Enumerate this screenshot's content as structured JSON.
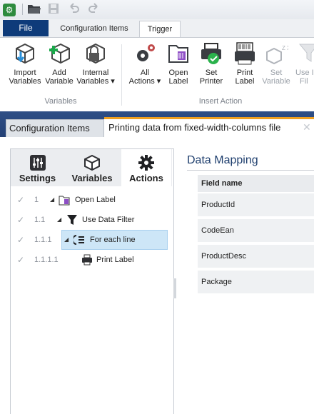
{
  "ribbon": {
    "tabs": {
      "file": "File",
      "config": "Configuration Items",
      "trigger": "Trigger"
    },
    "buttons": {
      "import_variables": [
        "Import",
        "Variables"
      ],
      "add_variable": [
        "Add",
        "Variable"
      ],
      "internal_variables": [
        "Internal",
        "Variables ▾"
      ],
      "all_actions": [
        "All",
        "Actions ▾"
      ],
      "open_label": [
        "Open",
        "Label"
      ],
      "set_printer": [
        "Set",
        "Printer"
      ],
      "print_label": [
        "Print",
        "Label"
      ],
      "set_variable": [
        "Set",
        "Variable"
      ],
      "use_filter_partial": [
        "Use I",
        "Fil"
      ]
    },
    "groups": {
      "variables": "Variables",
      "insert_action": "Insert Action"
    }
  },
  "documents": {
    "inactive_tab": "Configuration Items",
    "active_tab": "Printing data from fixed-width-columns file",
    "close": "✕"
  },
  "left_panel": {
    "tabs": {
      "settings": "Settings",
      "variables": "Variables",
      "actions": "Actions"
    },
    "tree": [
      {
        "num": "1",
        "label": "Open Label"
      },
      {
        "num": "1.1",
        "label": "Use Data Filter"
      },
      {
        "num": "1.1.1",
        "label": "For each line"
      },
      {
        "num": "1.1.1.1",
        "label": "Print Label"
      }
    ]
  },
  "data_mapping": {
    "title": "Data Mapping",
    "header": "Field name",
    "rows": [
      "ProductId",
      "CodeEan",
      "ProductDesc",
      "Package"
    ]
  }
}
